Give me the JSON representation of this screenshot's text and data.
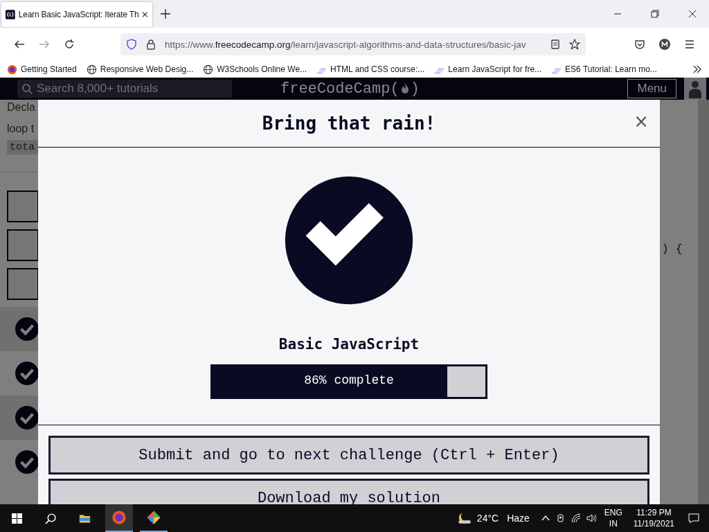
{
  "browser": {
    "tab": {
      "title": "Learn Basic JavaScript: Iterate Th",
      "selected": true
    },
    "url": {
      "scheme": "https://www.",
      "domain": "freecodecamp.org",
      "path": "/learn/javascript-algorithms-and-data-structures/basic-jav"
    },
    "bookmarks": [
      {
        "label": "Getting Started",
        "kind": "firefox"
      },
      {
        "label": "Responsive Web Desig...",
        "kind": "globe"
      },
      {
        "label": "W3Schools Online We...",
        "kind": "globe"
      },
      {
        "label": "HTML and CSS course:...",
        "kind": "stripes"
      },
      {
        "label": "Learn JavaScript for fre...",
        "kind": "stripes"
      },
      {
        "label": "ES6 Tutorial: Learn mo...",
        "kind": "stripes"
      }
    ]
  },
  "site_nav": {
    "search_placeholder": "Search 8,000+ tutorials",
    "logo_left": "freeCodeCamp(",
    "logo_right": ")",
    "menu": "Menu"
  },
  "background": {
    "lines": [
      "Decla",
      "loop t"
    ],
    "code": "tota",
    "code_right": ") {",
    "boxes": [
      {
        "checked": false
      },
      {
        "checked": false
      },
      {
        "checked": false
      }
    ],
    "tests": [
      {
        "passed": true
      },
      {
        "passed": true
      },
      {
        "passed": true
      },
      {
        "passed": true
      }
    ]
  },
  "modal": {
    "title": "Bring that rain!",
    "close": "×",
    "block": "Basic JavaScript",
    "progress": {
      "level": 0.86,
      "label": "86% complete"
    },
    "buttons": [
      "Submit and go to next challenge (Ctrl + Enter)",
      "Download my solution"
    ]
  },
  "taskbar": {
    "weather": {
      "temp": "24°C",
      "text": "Haze"
    },
    "lang": [
      "ENG",
      "IN"
    ],
    "time": "11:29 PM",
    "date": "11/19/2021"
  }
}
